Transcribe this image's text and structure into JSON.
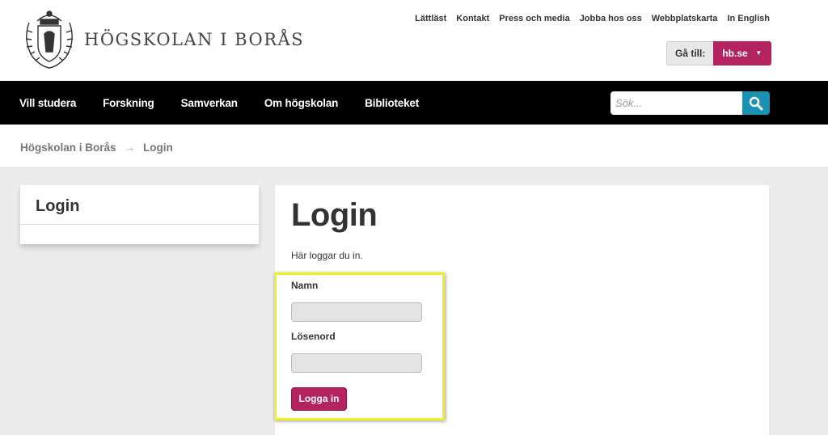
{
  "header": {
    "logo_text": "HÖGSKOLAN I BORÅS",
    "top_links": [
      "Lättläst",
      "Kontakt",
      "Press och media",
      "Jobba hos oss",
      "Webbplatskarta",
      "In English"
    ],
    "goto_label": "Gå till:",
    "goto_value": "hb.se"
  },
  "nav": {
    "items": [
      "Vill studera",
      "Forskning",
      "Samverkan",
      "Om högskolan",
      "Biblioteket"
    ],
    "search_placeholder": "Sök..."
  },
  "breadcrumb": {
    "home": "Högskolan i Borås",
    "arrow": "→",
    "current": "Login"
  },
  "sidebar": {
    "title": "Login"
  },
  "main": {
    "title": "Login",
    "intro": "Här loggar du in.",
    "name_label": "Namn",
    "password_label": "Lösenord",
    "submit_label": "Logga in"
  },
  "colors": {
    "brand": "#b4225f",
    "search": "#1a92b2",
    "nav_bg": "#000000",
    "highlight": "#f0f020"
  }
}
